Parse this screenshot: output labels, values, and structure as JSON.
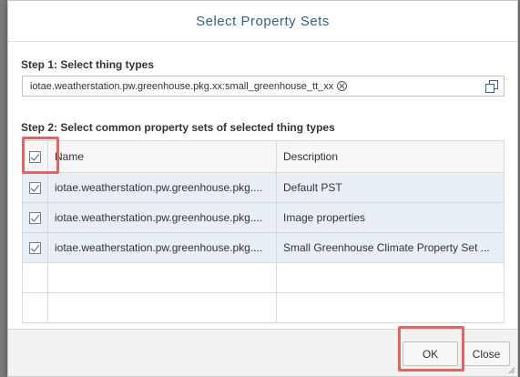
{
  "dialog": {
    "title": "Select Property Sets"
  },
  "step1": {
    "label": "Step 1: Select thing types",
    "tokens": [
      "iotae.weatherstation.pw.greenhouse.pkg.xx:small_greenhouse_tt_xx"
    ]
  },
  "step2": {
    "label": "Step 2: Select common property sets of selected thing types",
    "columns": {
      "name": "Name",
      "description": "Description"
    },
    "select_all_checked": true,
    "rows": [
      {
        "checked": true,
        "name": "iotae.weatherstation.pw.greenhouse.pkg....",
        "description": "Default PST"
      },
      {
        "checked": true,
        "name": "iotae.weatherstation.pw.greenhouse.pkg....",
        "description": "Image properties"
      },
      {
        "checked": true,
        "name": "iotae.weatherstation.pw.greenhouse.pkg....",
        "description": "Small Greenhouse Climate Property Set ..."
      }
    ]
  },
  "footer": {
    "ok_label": "OK",
    "close_label": "Close"
  },
  "colors": {
    "title": "#346187",
    "selected_row": "#e8eff6",
    "highlight": "#e06565"
  },
  "icons": {
    "token_remove": "circle-x-icon",
    "value_help": "copy-icon",
    "checkbox": "check-icon"
  }
}
